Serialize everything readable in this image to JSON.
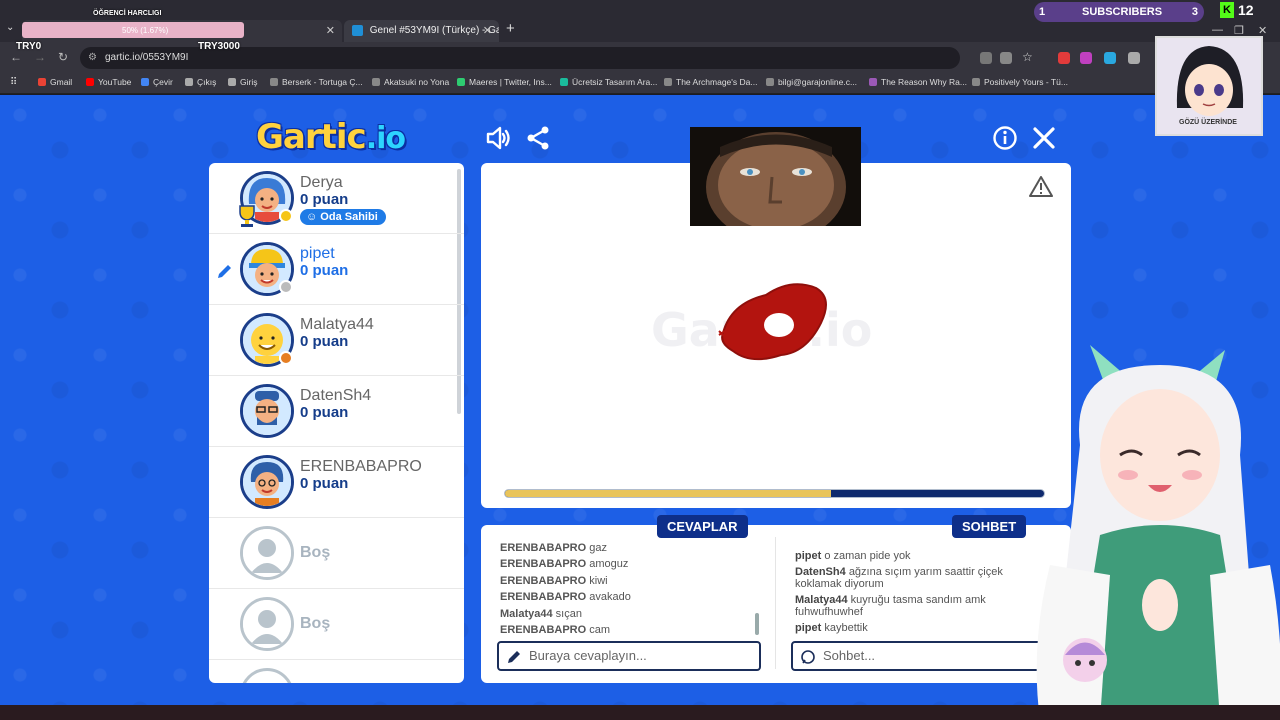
{
  "browser": {
    "tabs": [
      {
        "title": "50% (1.67%)",
        "overlay_label": "ÖĞRENCİ HARCLIGI"
      },
      {
        "title": "Genel #53YM9I (Türkçe) - Gartic"
      }
    ],
    "url": "gartic.io/0553YM9I",
    "bookmarks": [
      {
        "label": "Gmail",
        "color": "#ea4335"
      },
      {
        "label": "YouTube",
        "color": "#ff0000"
      },
      {
        "label": "Çevir",
        "color": "#4285f4"
      },
      {
        "label": "Çıkış",
        "color": "#aaaaaa"
      },
      {
        "label": "Giriş",
        "color": "#aaaaaa"
      },
      {
        "label": "Berserk - Tortuga Ç...",
        "color": "#888888"
      },
      {
        "label": "Akatsuki no Yona",
        "color": "#888888"
      },
      {
        "label": "Maeres | Twitter, Ins...",
        "color": "#2ecc71"
      },
      {
        "label": "Ücretsiz Tasarım Ara...",
        "color": "#1abc9c"
      },
      {
        "label": "The Archmage's Da...",
        "color": "#888888"
      },
      {
        "label": "bilgi@garajonline.c...",
        "color": "#888888"
      },
      {
        "label": "The Reason Why Ra...",
        "color": "#9b59b6"
      },
      {
        "label": "Positively Yours - Tü...",
        "color": "#888888"
      }
    ]
  },
  "overlay": {
    "try_left": "TRY0",
    "try_right": "TRY3000",
    "subscribers_label": "SUBSCRIBERS",
    "subscribers_left": "1",
    "subscribers_right": "3",
    "kick_count": "12",
    "portrait_caption": "GÖZÜ ÜZERİNDE"
  },
  "game": {
    "logo_main": "Gartic",
    "logo_suffix": ".io",
    "players": [
      {
        "name": "Derya",
        "score": "0 puan",
        "badge": "Oda Sahibi",
        "status": "#f5c518",
        "skin": "#f4b183",
        "hair": "#3a7bd5"
      },
      {
        "name": "pipet",
        "score": "0 puan",
        "status": "#bbbbbb",
        "skin": "#f4b183",
        "hair": "#f5c518"
      },
      {
        "name": "Malatya44",
        "score": "0 puan",
        "status": "#e67e22",
        "skin": "#ffd23e",
        "hair": "#ffd23e"
      },
      {
        "name": "DatenSh4",
        "score": "0 puan",
        "skin": "#f4b183",
        "hair": "#2e5fa8"
      },
      {
        "name": "ERENBABAPRO",
        "score": "0 puan",
        "skin": "#f4b183",
        "hair": "#2e5fa8"
      },
      {
        "name": "Boş"
      },
      {
        "name": "Boş"
      }
    ],
    "timer_progress": 0.605,
    "answers_tab": "CEVAPLAR",
    "chat_tab": "SOHBET",
    "answers": [
      {
        "user": "ERENBABAPRO",
        "text": "gaz"
      },
      {
        "user": "ERENBABAPRO",
        "text": "amoguz"
      },
      {
        "user": "ERENBABAPRO",
        "text": "kiwi"
      },
      {
        "user": "ERENBABAPRO",
        "text": "avakado"
      },
      {
        "user": "Malatya44",
        "text": "sıçan"
      },
      {
        "user": "ERENBABAPRO",
        "text": "cam"
      }
    ],
    "chat": [
      {
        "user": "pipet",
        "text": "o zaman pide yok"
      },
      {
        "user": "DatenSh4",
        "text": "ağzına sıçım yarım saattir çiçek koklamak diyorum"
      },
      {
        "user": "Malatya44",
        "text": "kuyruğu tasma sandım amk fuhwufhuwhef"
      },
      {
        "user": "pipet",
        "text": "kaybettik"
      }
    ],
    "answer_placeholder": "Buraya cevaplayın...",
    "chat_placeholder": "Sohbet..."
  },
  "colors": {
    "page_bg": "#1d5fe6",
    "panel_navy": "#0e2f8a",
    "drawing_red": "#b3140f"
  }
}
